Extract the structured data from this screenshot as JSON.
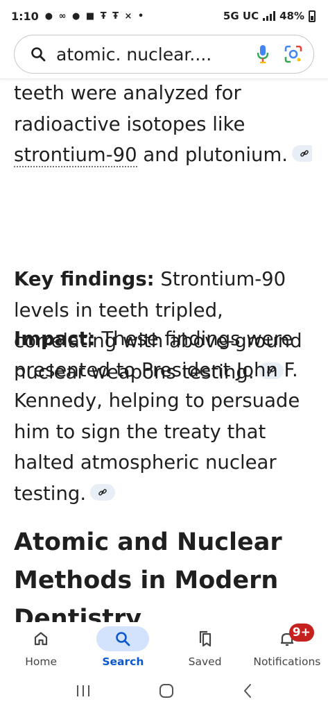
{
  "status_bar": {
    "time": "1:10",
    "notification_icons": "● ∞ ● ■ Ŧ Ŧ ⨯ •",
    "network": "5G UC",
    "battery": "48%"
  },
  "search": {
    "query": "atomic. nuclear...."
  },
  "article": {
    "p1": {
      "before_link": "teeth were analyzed for radioactive isotopes like ",
      "link_text": "strontium-90",
      "after_link": " and plutonium."
    },
    "p2": {
      "label": "Key findings:",
      "text": " Strontium-90 levels in teeth tripled, correlating with above-ground nuclear weapons testing."
    },
    "p3": {
      "label": "Impact:",
      "text": " These findings were presented to President John F. Kennedy, helping to persuade him to sign the treaty that halted atmospheric nuclear testing."
    },
    "heading": "Atomic and Nuclear Methods in Modern Dentistry"
  },
  "bottom_nav": {
    "items": [
      {
        "label": "Home",
        "icon": "home-icon"
      },
      {
        "label": "Search",
        "icon": "search-icon",
        "active": true
      },
      {
        "label": "Saved",
        "icon": "bookmarks-icon"
      },
      {
        "label": "Notifications",
        "icon": "bell-icon",
        "badge": "9+"
      }
    ]
  },
  "colors": {
    "accent": "#0b57d0",
    "active_pill": "#d3e3fd",
    "badge": "#c5221f",
    "link_chip": "#e8eef6"
  }
}
